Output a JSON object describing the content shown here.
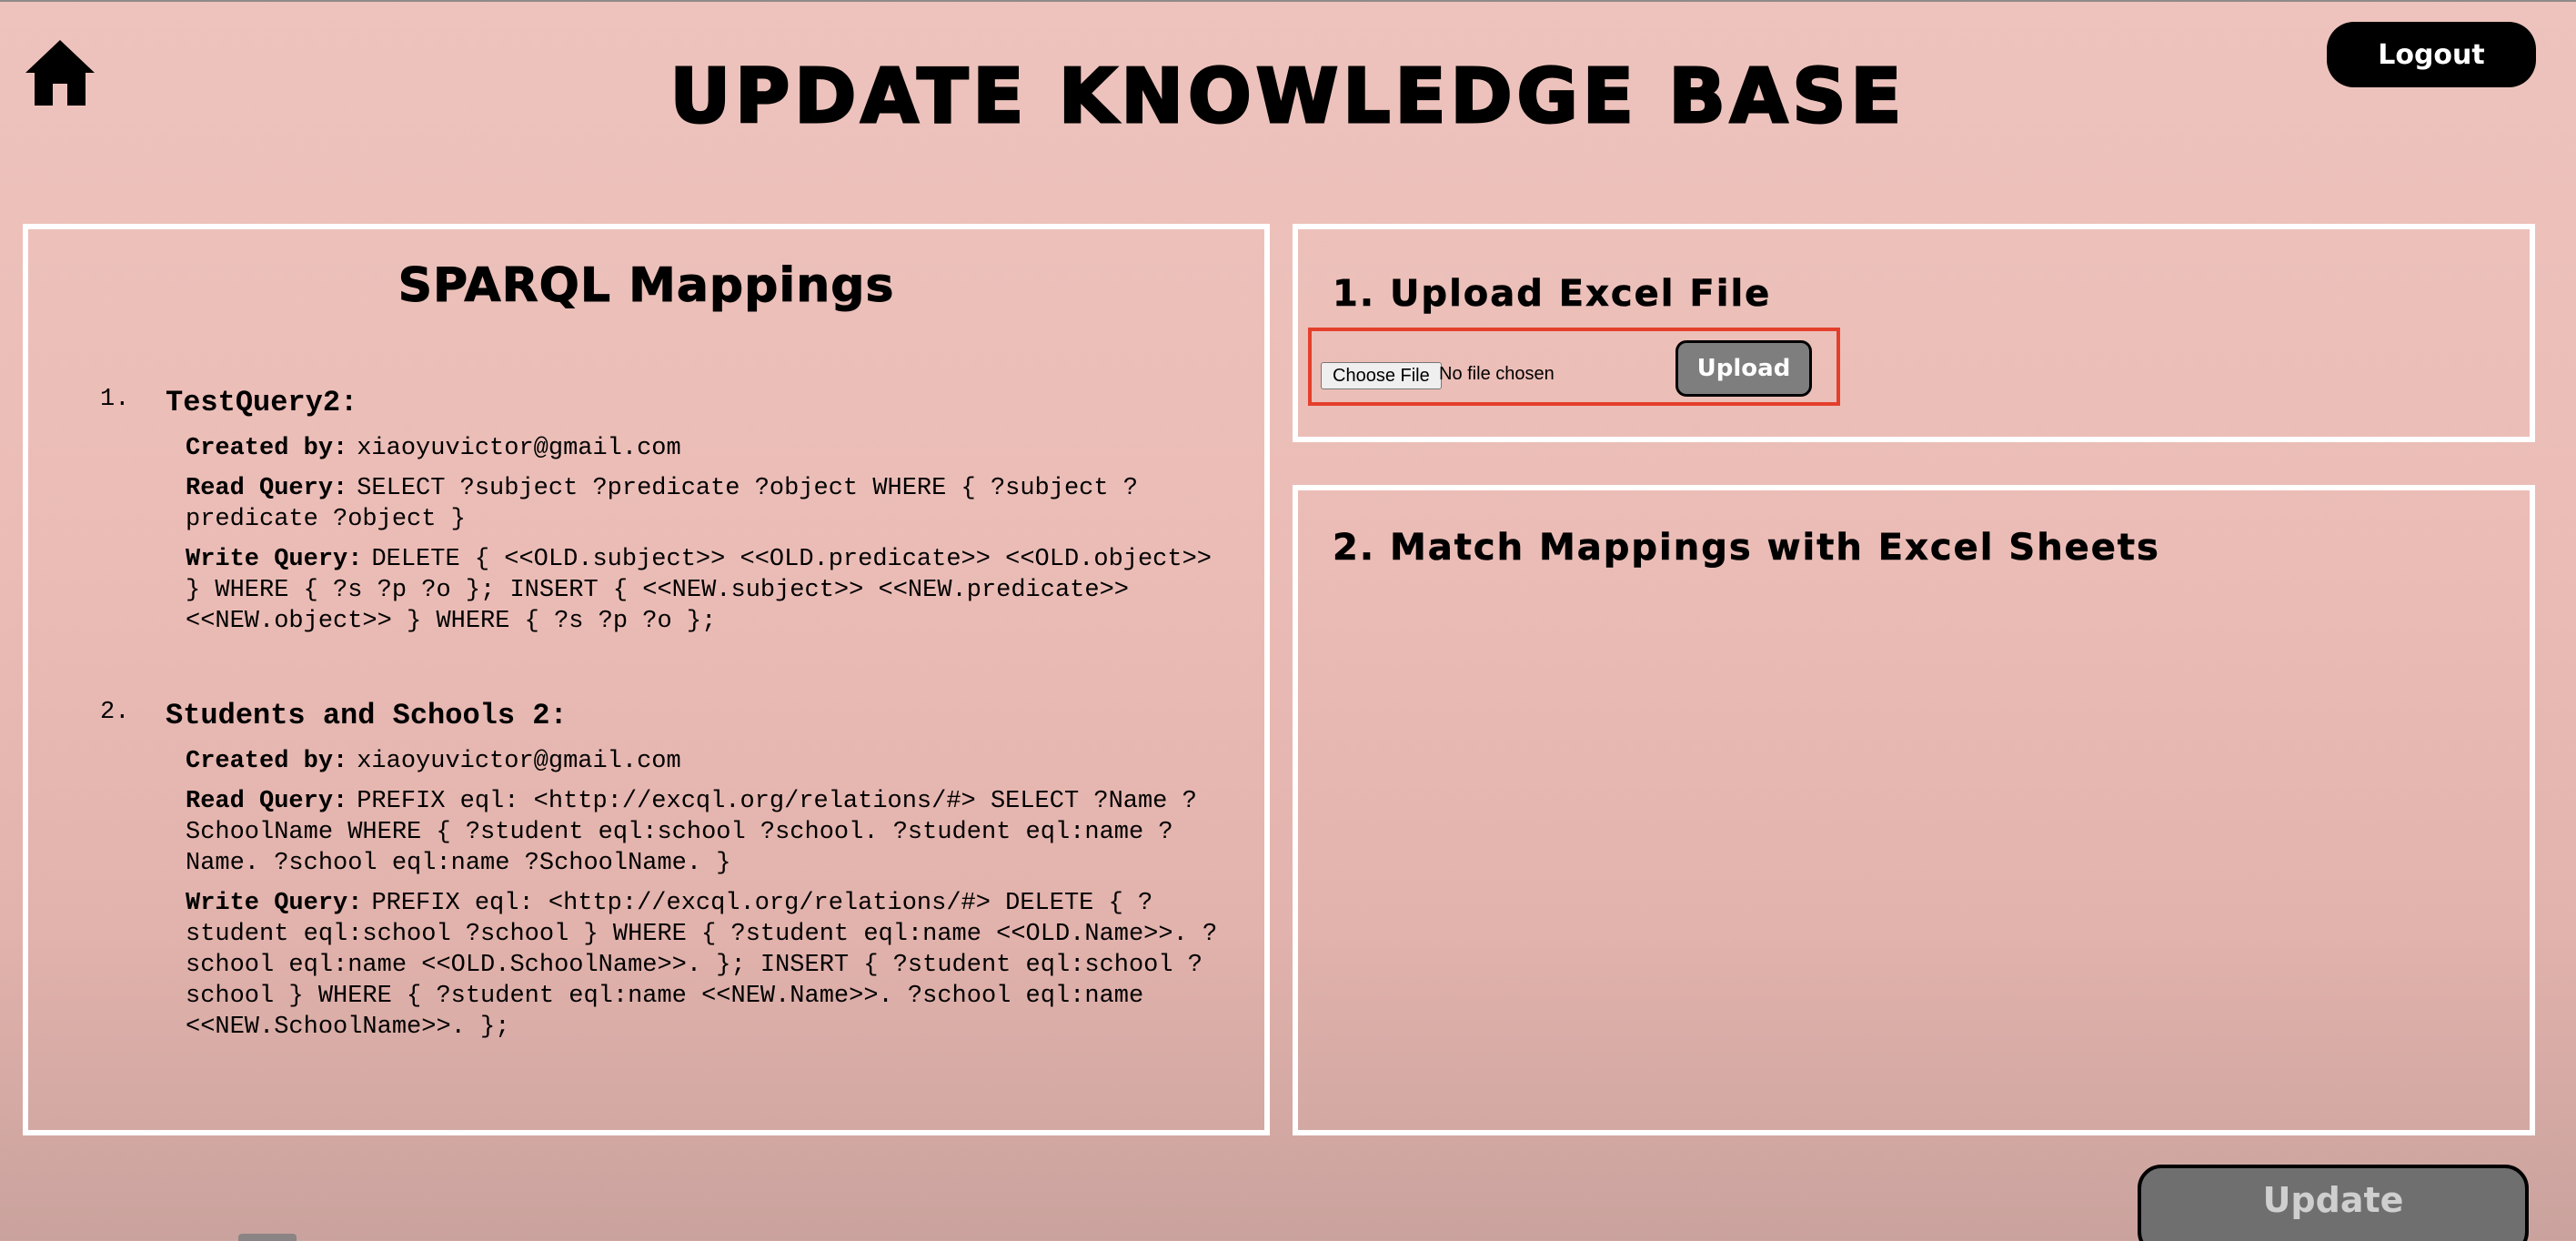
{
  "header": {
    "title": "UPDATE KNOWLEDGE BASE",
    "logout_label": "Logout",
    "home_icon": "home-icon"
  },
  "mappings": {
    "title": "SPARQL Mappings",
    "items": [
      {
        "number": "1.",
        "name": "TestQuery2:",
        "created_by_label": "Created by:",
        "created_by": "xiaoyuvictor@gmail.com",
        "read_label": "Read Query:",
        "read_query": "SELECT ?subject ?predicate ?object WHERE { ?subject ?predicate ?object }",
        "write_label": "Write Query:",
        "write_query": "DELETE { <<OLD.subject>> <<OLD.predicate>> <<OLD.object>> } WHERE { ?s ?p ?o }; INSERT { <<NEW.subject>> <<NEW.predicate>> <<NEW.object>> } WHERE { ?s ?p ?o };"
      },
      {
        "number": "2.",
        "name": "Students and Schools 2:",
        "created_by_label": "Created by:",
        "created_by": "xiaoyuvictor@gmail.com",
        "read_label": "Read Query:",
        "read_query": "PREFIX eql: <http://excql.org/relations/#> SELECT ?Name ?SchoolName WHERE { ?student eql:school ?school. ?student eql:name ?Name. ?school eql:name ?SchoolName. }",
        "write_label": "Write Query:",
        "write_query": "PREFIX eql: <http://excql.org/relations/#> DELETE { ?student eql:school ?school } WHERE { ?student eql:name <<OLD.Name>>. ?school eql:name <<OLD.SchoolName>>. }; INSERT { ?student eql:school ?school } WHERE { ?student eql:name <<NEW.Name>>. ?school eql:name <<NEW.SchoolName>>. };"
      }
    ]
  },
  "upload": {
    "title": "1. Upload Excel File",
    "choose_file_label": "Choose File",
    "file_status": "No file chosen",
    "upload_label": "Upload"
  },
  "match": {
    "title": "2. Match Mappings with Excel Sheets"
  },
  "footer": {
    "update_label": "Update"
  },
  "colors": {
    "background": "#ebbcb6",
    "panel_border": "#ffffff",
    "highlight_border": "#e33f2b",
    "button_dark": "#000000",
    "button_gray": "#7e7e7e"
  }
}
